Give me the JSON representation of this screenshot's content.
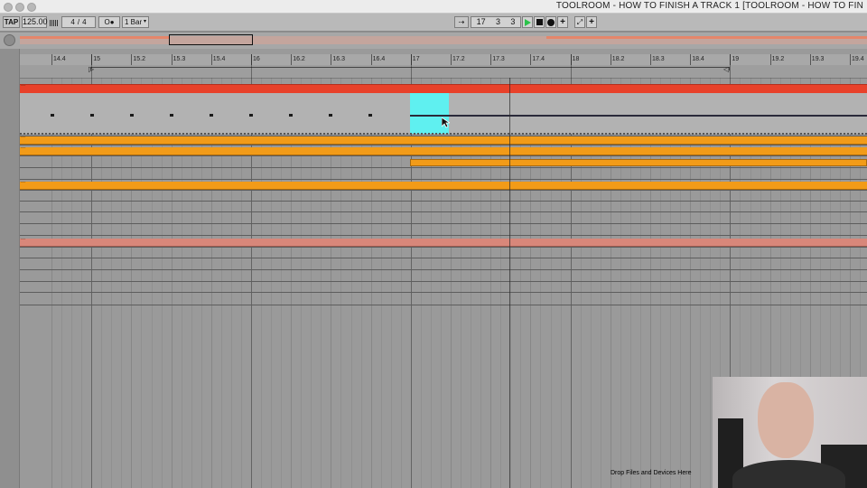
{
  "window": {
    "title": "TOOLROOM - HOW TO FINISH A TRACK 1  [TOOLROOM - HOW TO FIN"
  },
  "control_bar": {
    "tap_label": "TAP",
    "tempo": "125.00",
    "nudge_icon": "nudge-bars-icon",
    "time_signature_num": "4",
    "time_signature_sep": "/",
    "time_signature_den": "4",
    "metronome_label": "O●",
    "quantize_value": "1 Bar",
    "follow_icon": "follow-arrow-icon",
    "position_bar": "17",
    "position_beat": "3",
    "position_sixteenth": "3",
    "play_icon": "play-icon",
    "stop_icon": "stop-icon",
    "record_icon": "record-icon",
    "overdub_label": "+",
    "midi_map_icon": "key-map-icon",
    "add_label": "+"
  },
  "ruler": {
    "labels": [
      "14.4",
      "15",
      "15.2",
      "15.3",
      "15.4",
      "16",
      "16.2",
      "16.3",
      "16.4",
      "17",
      "17.2",
      "17.3",
      "17.4",
      "18",
      "18.2",
      "18.3",
      "18.4",
      "19",
      "19.2",
      "19.3",
      "19.4"
    ]
  },
  "colors": {
    "red_clip": "#e8412a",
    "orange_clip": "#f29b18",
    "salmon_clip": "#d8877a",
    "selection": "#5ff0f0",
    "play_green": "#2bc24a"
  },
  "tracks": {
    "clip_marker": "..."
  },
  "drop_hint": "Drop Files and Devices Here"
}
